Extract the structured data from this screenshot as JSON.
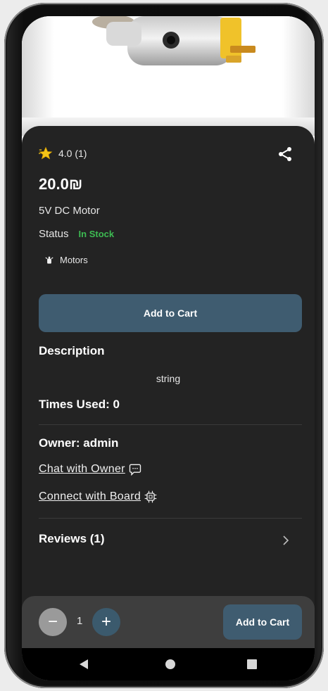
{
  "product": {
    "rating": "4.0 (1)",
    "price": "20.0₪",
    "name": "5V DC Motor",
    "status_label": "Status",
    "status_value": "In Stock",
    "category": "Motors",
    "add_to_cart": "Add to Cart",
    "description_heading": "Description",
    "description": "string",
    "times_used": "Times Used: 0",
    "owner": "Owner: admin",
    "chat_link": "Chat with Owner",
    "connect_link": "Connect with Board",
    "reviews": "Reviews (1)"
  },
  "cart_bar": {
    "quantity": "1",
    "minus": "−",
    "plus": "+",
    "add_to_cart": "Add to Cart"
  },
  "colors": {
    "panel": "#232323",
    "accent": "#3f5c70",
    "in_stock": "#3dbb52",
    "star": "#f5c518"
  },
  "icons": {
    "rating": "star-icon",
    "share": "share-icon",
    "category": "motor-icon",
    "chat": "chat-bubble-icon",
    "board": "chip-icon",
    "reviews": "chevron-right-icon",
    "nav": [
      "back-icon",
      "home-icon",
      "recents-icon"
    ]
  }
}
